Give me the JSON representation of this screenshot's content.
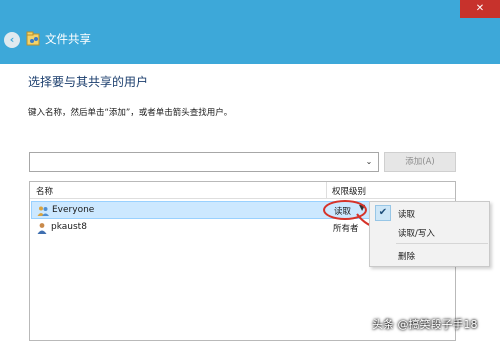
{
  "window": {
    "title": "文件共享",
    "close_glyph": "✕",
    "back_glyph": "‹"
  },
  "main": {
    "heading": "选择要与其共享的用户",
    "instruction": "键入名称，然后单击“添加”，或者单击箭头查找用户。"
  },
  "input": {
    "value": "",
    "dropdown_glyph": "⌄",
    "add_button_label": "添加(A)",
    "add_button_enabled": false
  },
  "list": {
    "columns": {
      "name": "名称",
      "permission": "权限级别"
    },
    "rows": [
      {
        "name": "Everyone",
        "permission": "读取",
        "selected": true,
        "icon": "group-icon",
        "perm_arrow": "▼"
      },
      {
        "name": "pkaust8",
        "permission": "所有者",
        "selected": false,
        "icon": "user-icon"
      }
    ]
  },
  "context_menu": {
    "check_glyph": "✔",
    "items": [
      {
        "label": "读取",
        "checked": true
      },
      {
        "label": "读取/写入",
        "checked": false
      },
      {
        "label": "删除",
        "checked": false
      }
    ]
  },
  "watermark": "头条 @搞笑段子手18",
  "colors": {
    "titlebar": "#3da8d9",
    "close": "#c7322c",
    "heading": "#1c3f6e",
    "selection": "#cce8ff",
    "annotation": "#d6332a"
  }
}
